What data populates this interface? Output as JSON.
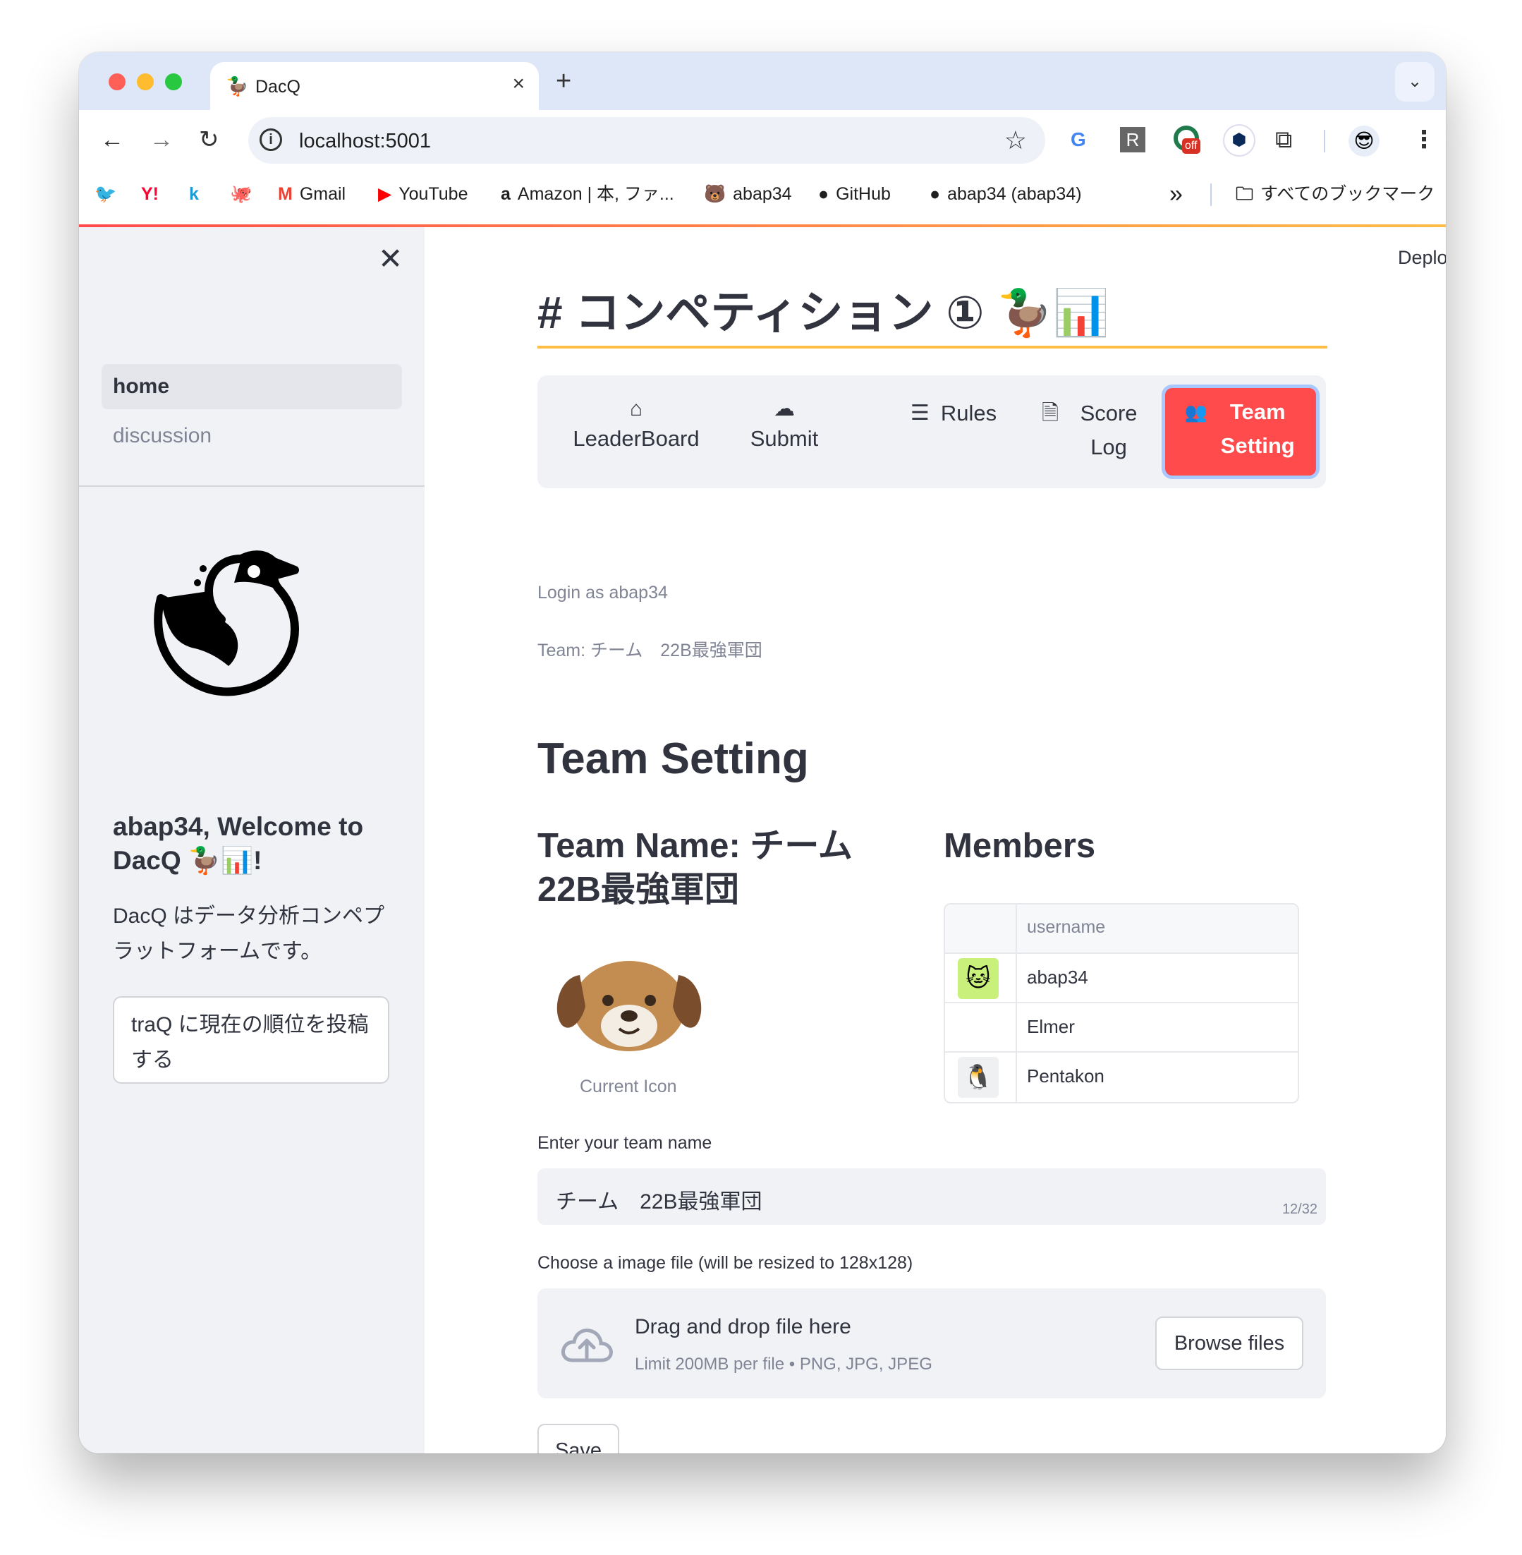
{
  "browser": {
    "tab": {
      "favicon": "🦆",
      "title": "DacQ",
      "close": "×"
    },
    "new_tab": "+",
    "tab_dropdown": "⌄",
    "nav": {
      "back": "←",
      "forward": "→",
      "reload": "↻"
    },
    "address": "localhost:5001",
    "info_icon": "i",
    "star": "☆",
    "extensions": {
      "translate": "G",
      "r": "R",
      "off_badge": "off",
      "hex": "⬢",
      "puzzle": "⧉",
      "profile": "😎",
      "menu": "⋮"
    },
    "bookmarks": [
      {
        "icon": "🐦",
        "label": ""
      },
      {
        "icon": "Y!",
        "label": ""
      },
      {
        "icon": "k",
        "label": ""
      },
      {
        "icon": "🐙",
        "label": ""
      },
      {
        "icon": "M",
        "label": "Gmail"
      },
      {
        "icon": "▶",
        "label": "YouTube"
      },
      {
        "icon": "a",
        "label": "Amazon | 本, ファ..."
      },
      {
        "icon": "🐻",
        "label": "abap34"
      },
      {
        "icon": "●",
        "label": "GitHub"
      },
      {
        "icon": "●",
        "label": "abap34 (abap34)"
      }
    ],
    "bookmarks_overflow": "»",
    "all_bookmarks": "すべてのブックマーク",
    "folder_icon": "🗀"
  },
  "colors": {
    "accent": "#ff4b4b",
    "title_underline": "#ffbd45",
    "sidebar_bg": "#f0f2f6",
    "text": "#31333f",
    "muted": "#808495"
  },
  "sidebar": {
    "close": "✕",
    "nav": {
      "home": "home",
      "discussion": "discussion"
    },
    "welcome": "abap34, Welcome to DacQ 🦆📊!",
    "description": "DacQ はデータ分析コンペプラットフォームです。",
    "traq_button": "traQ に現在の順位を投稿する"
  },
  "header": {
    "deploy": "Deploy",
    "menu": "⋮"
  },
  "main": {
    "title": "# コンペティション ① 🦆📊",
    "menu": [
      {
        "icon": "⌂",
        "label": "LeaderBoard"
      },
      {
        "icon": "☁",
        "label": "Submit"
      },
      {
        "icon": "☰",
        "label": "Rules"
      },
      {
        "icon": "🗎",
        "label": "Score Log"
      },
      {
        "icon": "👥",
        "label": "Team Setting"
      }
    ],
    "login_text": "Login as abap34",
    "team_text": "Team: チーム　22B最強軍団",
    "heading": "Team Setting",
    "team_name_heading": "Team Name: チーム 22B最強軍団",
    "current_icon_label": "Current Icon",
    "members_heading": "Members",
    "members_table": {
      "column": "username",
      "rows": [
        {
          "username": "abap34",
          "avatar": "🐱"
        },
        {
          "username": "Elmer",
          "avatar": ""
        },
        {
          "username": "Pentakon",
          "avatar": "🐧"
        }
      ]
    },
    "team_name_field": {
      "label": "Enter your team name",
      "value": "チーム　22B最強軍団",
      "counter": "12/32"
    },
    "file_field": {
      "label": "Choose a image file (will be resized to 128x128)",
      "drop_text": "Drag and drop file here",
      "limit_text": "Limit 200MB per file • PNG, JPG, JPEG",
      "browse": "Browse files"
    },
    "save": "Save"
  }
}
